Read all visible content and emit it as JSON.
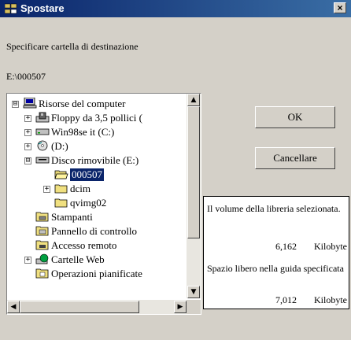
{
  "window": {
    "title": "Spostare",
    "close_label": "×"
  },
  "prompt": "Specificare cartella di destinazione",
  "current_path": "E:\\000507",
  "tree": {
    "items": [
      {
        "label": "Risorse del computer",
        "icon": "computer-icon"
      },
      {
        "label": "Floppy da 3,5 pollici (",
        "icon": "floppy-icon"
      },
      {
        "label": "Win98se it (C:)",
        "icon": "drive-icon"
      },
      {
        "label": "(D:)",
        "icon": "cd-drive-icon"
      },
      {
        "label": "Disco rimovibile (E:)",
        "icon": "removable-drive-icon"
      },
      {
        "label": "000507",
        "icon": "folder-open-icon"
      },
      {
        "label": "dcim",
        "icon": "folder-icon"
      },
      {
        "label": "qvimg02",
        "icon": "folder-icon"
      },
      {
        "label": "Stampanti",
        "icon": "printers-icon"
      },
      {
        "label": "Pannello di controllo",
        "icon": "control-panel-icon"
      },
      {
        "label": "Accesso remoto",
        "icon": "dialup-icon"
      },
      {
        "label": "Cartelle Web",
        "icon": "web-folders-icon"
      },
      {
        "label": "Operazioni pianificate",
        "icon": "scheduled-tasks-icon"
      }
    ],
    "expanders": [
      "⊟",
      "+",
      "+",
      "+",
      "⊟",
      "+",
      "+"
    ]
  },
  "buttons": {
    "ok": "OK",
    "cancel": "Cancellare"
  },
  "info": {
    "volume_label": "Il volume della libreria selezionata.",
    "volume_value": "6,162",
    "volume_unit": "Kilobyte",
    "free_label": "Spazio libero nella guida specificata",
    "free_value": "7,012",
    "free_unit": "Kilobyte"
  }
}
